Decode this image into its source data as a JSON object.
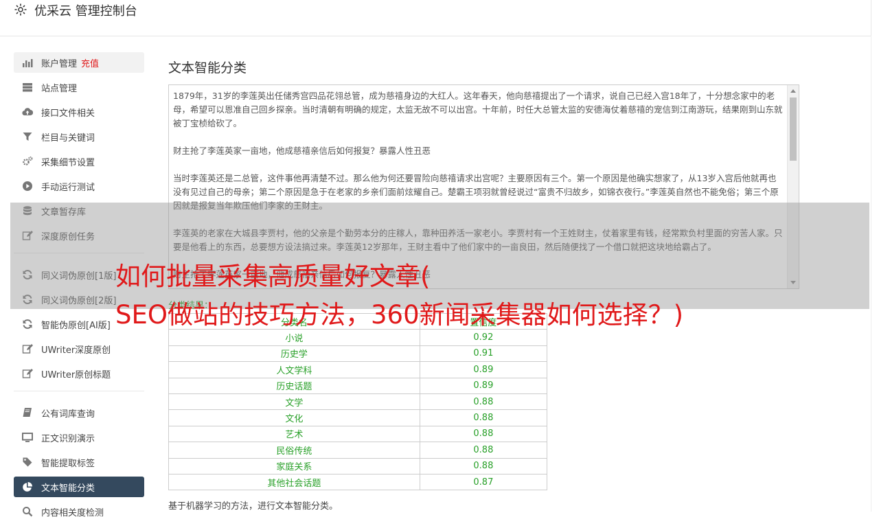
{
  "header": {
    "title": "优采云 管理控制台",
    "icon": "gear-icon"
  },
  "sidebar": {
    "groups": [
      [
        {
          "label": "账户管理",
          "extra": "充值",
          "icon": "bar-chart-icon",
          "state": "hl"
        },
        {
          "label": "站点管理",
          "icon": "server-icon"
        },
        {
          "label": "接口文件相关",
          "icon": "cloud-upload-icon"
        },
        {
          "label": "栏目与关键词",
          "icon": "filter-icon"
        },
        {
          "label": "采集细节设置",
          "icon": "gears-icon"
        },
        {
          "label": "手动运行测试",
          "icon": "play-circle-icon"
        },
        {
          "label": "文章暂存库",
          "icon": "database-icon"
        },
        {
          "label": "深度原创任务",
          "icon": "edit-icon"
        }
      ],
      [
        {
          "label": "同义词伪原创[1版]",
          "icon": "refresh-icon"
        },
        {
          "label": "同义词伪原创[2版]",
          "icon": "refresh-icon"
        },
        {
          "label": "智能伪原创[AI版]",
          "icon": "refresh-icon"
        },
        {
          "label": "UWriter深度原创",
          "icon": "edit-icon"
        },
        {
          "label": "UWriter原创标题",
          "icon": "edit-icon"
        }
      ],
      [
        {
          "label": "公有词库查询",
          "icon": "book-icon"
        },
        {
          "label": "正文识别演示",
          "icon": "monitor-icon"
        },
        {
          "label": "智能提取标签",
          "icon": "tag-icon"
        },
        {
          "label": "文本智能分类",
          "icon": "pie-chart-icon",
          "state": "active"
        },
        {
          "label": "内容相关度检测",
          "icon": "search-icon"
        }
      ]
    ]
  },
  "main": {
    "title": "文本智能分类",
    "text_paragraphs": [
      "1879年，31岁的李莲英出任储秀宫四品花翎总管，成为慈禧身边的大红人。这年春天，他向慈禧提出了一个请求，说自己已经入宫18年了，十分想念家中的老母，希望可以恩准自己回乡探亲。当时清朝有明确的规定，太监无故不可以出宫。十年前，时任大总管太监的安德海仗着慈禧的宠信到江南游玩，结果刚到山东就被丁宝桢给砍了。",
      "财主抢了李莲英家一亩地，他成慈禧亲信后如何报复？暴露人性丑恶",
      "当时李莲英还是二总管，这件事他再清楚不过。那么他为何还要冒险向慈禧请求出宫呢？主要原因有三个。第一个原因是他确实想家了，从13岁入宫后他就再也没有见过自己的母亲；第二个原因是急于在老家的乡亲们面前炫耀自己。楚霸王项羽就曾经说过“富贵不归故乡，如锦衣夜行。”李莲英自然也不能免俗；第三个原因就是报复当年欺压他们李家的王财主。",
      "李莲英的老家在大城县李贾村，他的父亲是个勤劳本分的庄稼人，靠种田养活一家老小。李贾村有一个王姓财主，仗着家里有钱，经常欺负村里面的穷苦人家。只要是他看上的东西，总要想方设法搞过来。李莲英12岁那年，王财主看中了他们家中的一亩良田，然后随便找了一个借口就把这块地给霸占了。",
      "财主抢了李莲英家一亩地，他成慈禧亲信后如何报复？暴露人性丑恶"
    ],
    "result_label": "分类结果：",
    "table": {
      "headers": [
        "分类名",
        "置信度"
      ],
      "rows": [
        [
          "小说",
          "0.92"
        ],
        [
          "历史学",
          "0.91"
        ],
        [
          "人文学科",
          "0.89"
        ],
        [
          "历史话题",
          "0.89"
        ],
        [
          "文学",
          "0.88"
        ],
        [
          "文化",
          "0.88"
        ],
        [
          "艺术",
          "0.88"
        ],
        [
          "民俗传统",
          "0.88"
        ],
        [
          "家庭关系",
          "0.88"
        ],
        [
          "其他社会话题",
          "0.87"
        ]
      ]
    },
    "footnote": "基于机器学习的方法，进行文本智能分类。"
  },
  "overlay": {
    "title_line1": "如何批量采集高质量好文章(",
    "title_line2": "SEO做站的技巧方法，360新闻采集器如何选择？)"
  },
  "colors": {
    "sidebar_active": "#34495e",
    "accent_red": "#e0191a",
    "result_green": "#28a028"
  }
}
